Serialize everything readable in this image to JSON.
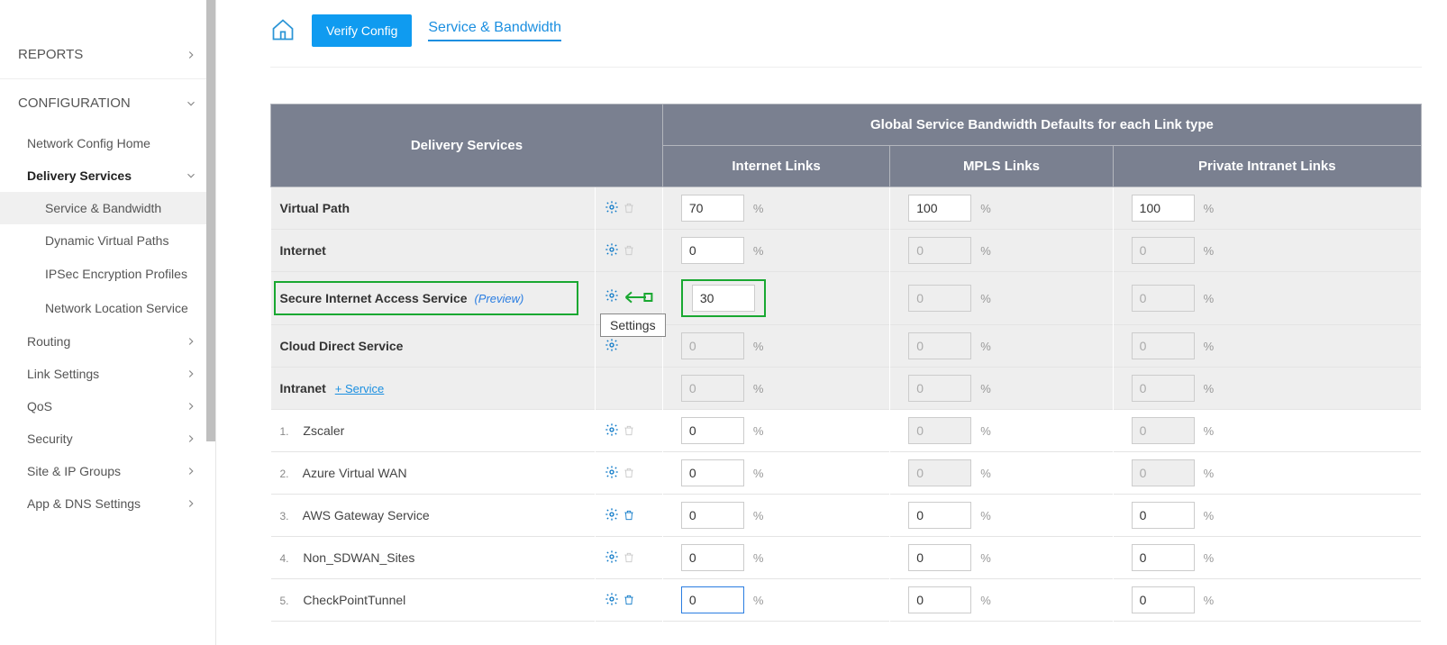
{
  "sidebar": {
    "reports": "REPORTS",
    "configuration": "CONFIGURATION",
    "items": [
      {
        "label": "Network Config Home"
      },
      {
        "label": "Delivery Services"
      }
    ],
    "subs": [
      {
        "label": "Service & Bandwidth"
      },
      {
        "label": "Dynamic Virtual Paths"
      },
      {
        "label": "IPSec Encryption Profiles"
      },
      {
        "label": "Network Location Service"
      }
    ],
    "tail": [
      {
        "label": "Routing"
      },
      {
        "label": "Link Settings"
      },
      {
        "label": "QoS"
      },
      {
        "label": "Security"
      },
      {
        "label": "Site & IP Groups"
      },
      {
        "label": "App & DNS Settings"
      }
    ]
  },
  "topbar": {
    "verify": "Verify Config",
    "crumb": "Service & Bandwidth"
  },
  "table": {
    "head": {
      "ds": "Delivery Services",
      "global": "Global Service Bandwidth Defaults for each Link type",
      "internet": "Internet Links",
      "mpls": "MPLS Links",
      "private": "Private Intranet Links"
    },
    "rows": {
      "vp": {
        "name": "Virtual Path",
        "internet": "70",
        "mpls": "100",
        "private": "100"
      },
      "inet": {
        "name": "Internet",
        "internet": "0",
        "mpls": "0",
        "private": "0"
      },
      "sia": {
        "name": "Secure Internet Access Service",
        "preview": "(Preview)",
        "internet": "30",
        "mpls": "0",
        "private": "0"
      },
      "cds": {
        "name": "Cloud Direct Service",
        "internet": "0",
        "mpls": "0",
        "private": "0"
      },
      "intra": {
        "name": "Intranet",
        "add": "+ Service",
        "internet": "0",
        "mpls": "0",
        "private": "0"
      },
      "sub": [
        {
          "num": "1.",
          "name": "Zscaler",
          "internet": "0",
          "mpls": "0",
          "private": "0",
          "trash": "disabled"
        },
        {
          "num": "2.",
          "name": "Azure Virtual WAN",
          "internet": "0",
          "mpls": "0",
          "private": "0",
          "trash": "disabled"
        },
        {
          "num": "3.",
          "name": "AWS Gateway Service",
          "internet": "0",
          "mpls": "0",
          "private": "0",
          "trash": "enabled"
        },
        {
          "num": "4.",
          "name": "Non_SDWAN_Sites",
          "internet": "0",
          "mpls": "0",
          "private": "0",
          "trash": "disabled"
        },
        {
          "num": "5.",
          "name": "CheckPointTunnel",
          "internet": "0",
          "mpls": "0",
          "private": "0",
          "trash": "enabled",
          "focused": true
        }
      ]
    },
    "pct": "%"
  },
  "tooltip": "Settings"
}
